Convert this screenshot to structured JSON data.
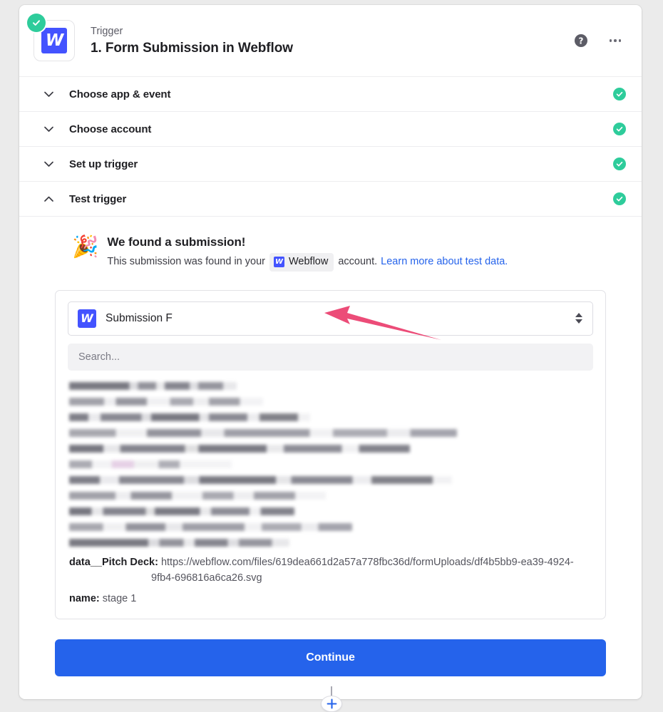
{
  "header": {
    "kicker": "Trigger",
    "title": "1. Form Submission in Webflow",
    "app_icon_letter": "W",
    "brand_color": "#4353ff",
    "status_color": "#2ecc9b",
    "help_label": "?"
  },
  "sections": [
    {
      "label": "Choose app & event",
      "state": "collapsed",
      "complete": true
    },
    {
      "label": "Choose account",
      "state": "collapsed",
      "complete": true
    },
    {
      "label": "Set up trigger",
      "state": "collapsed",
      "complete": true
    },
    {
      "label": "Test trigger",
      "state": "expanded",
      "complete": true
    }
  ],
  "test_trigger": {
    "emoji": "🎉",
    "found_title": "We found a submission!",
    "found_prefix": "This submission was found in your",
    "app_chip": {
      "letter": "W",
      "label": "Webflow"
    },
    "found_suffix": "account.",
    "learn_link": "Learn more about test data.",
    "record_select": {
      "icon_letter": "W",
      "value": "Submission F"
    },
    "search_placeholder": "Search...",
    "fields": [
      {
        "key": "data__Pitch Deck:",
        "value": "https://webflow.com/files/619dea661d2a57a778fbc36d/formUploads/df4b5bb9-ea39-4924-9fb4-696816a6ca26.svg"
      },
      {
        "key": "name:",
        "value": "stage 1"
      }
    ],
    "redacted_row_count": 12,
    "continue_label": "Continue",
    "annotation_arrow_color": "#ec4c78"
  },
  "connector": {
    "add_step_label": "+",
    "add_step_color": "#2563eb"
  }
}
